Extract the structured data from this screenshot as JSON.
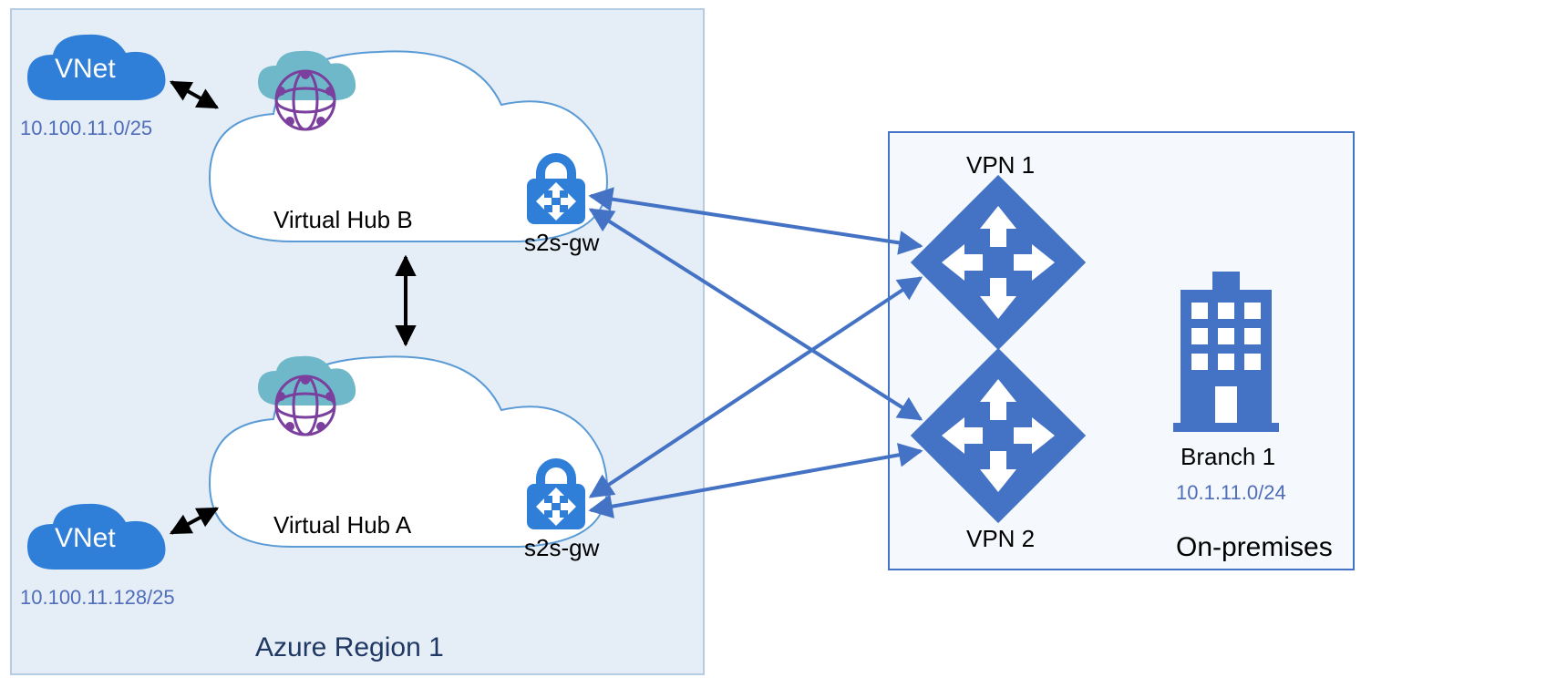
{
  "azureRegion": {
    "label": "Azure Region 1"
  },
  "vnetB": {
    "label": "VNet",
    "cidr": "10.100.11.0/25"
  },
  "vnetA": {
    "label": "VNet",
    "cidr": "10.100.11.128/25"
  },
  "hubB": {
    "label": "Virtual Hub B",
    "gwLabel": "s2s-gw"
  },
  "hubA": {
    "label": "Virtual Hub A",
    "gwLabel": "s2s-gw"
  },
  "onprem": {
    "label": "On-premises",
    "vpn1": "VPN 1",
    "vpn2": "VPN 2",
    "branchLabel": "Branch 1",
    "branchCidr": "10.1.11.0/24"
  }
}
